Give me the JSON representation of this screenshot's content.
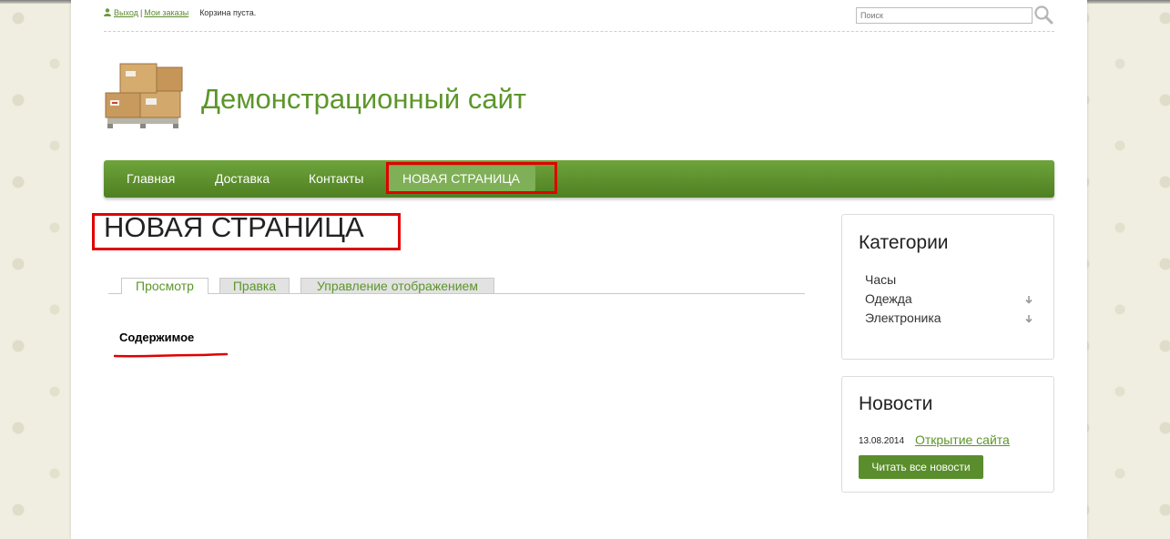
{
  "userbar": {
    "logout": "Выход",
    "separator": "|",
    "orders": "Мои заказы",
    "cart": "Корзина пуста."
  },
  "search": {
    "placeholder": "Поиск"
  },
  "header": {
    "site_title": "Демонстрационный сайт"
  },
  "nav": {
    "items": [
      {
        "label": "Главная"
      },
      {
        "label": "Доставка"
      },
      {
        "label": "Контакты"
      },
      {
        "label": "НОВАЯ СТРАНИЦА",
        "active": true
      }
    ]
  },
  "main": {
    "title": "НОВАЯ СТРАНИЦА",
    "tabs": [
      {
        "label": "Просмотр",
        "active": true
      },
      {
        "label": "Правка"
      },
      {
        "label": "Управление отображением"
      }
    ],
    "content_label": "Содержимое"
  },
  "sidebar": {
    "categories": {
      "title": "Категории",
      "items": [
        {
          "label": "Часы"
        },
        {
          "label": "Одежда",
          "expandable": true
        },
        {
          "label": "Электроника",
          "expandable": true
        }
      ]
    },
    "news": {
      "title": "Новости",
      "date": "13.08.2014",
      "link": "Открытие сайта",
      "button": "Читать все новости"
    }
  },
  "colors": {
    "accent": "#5c962a",
    "nav": "#5e932f",
    "highlight": "#e00000"
  }
}
